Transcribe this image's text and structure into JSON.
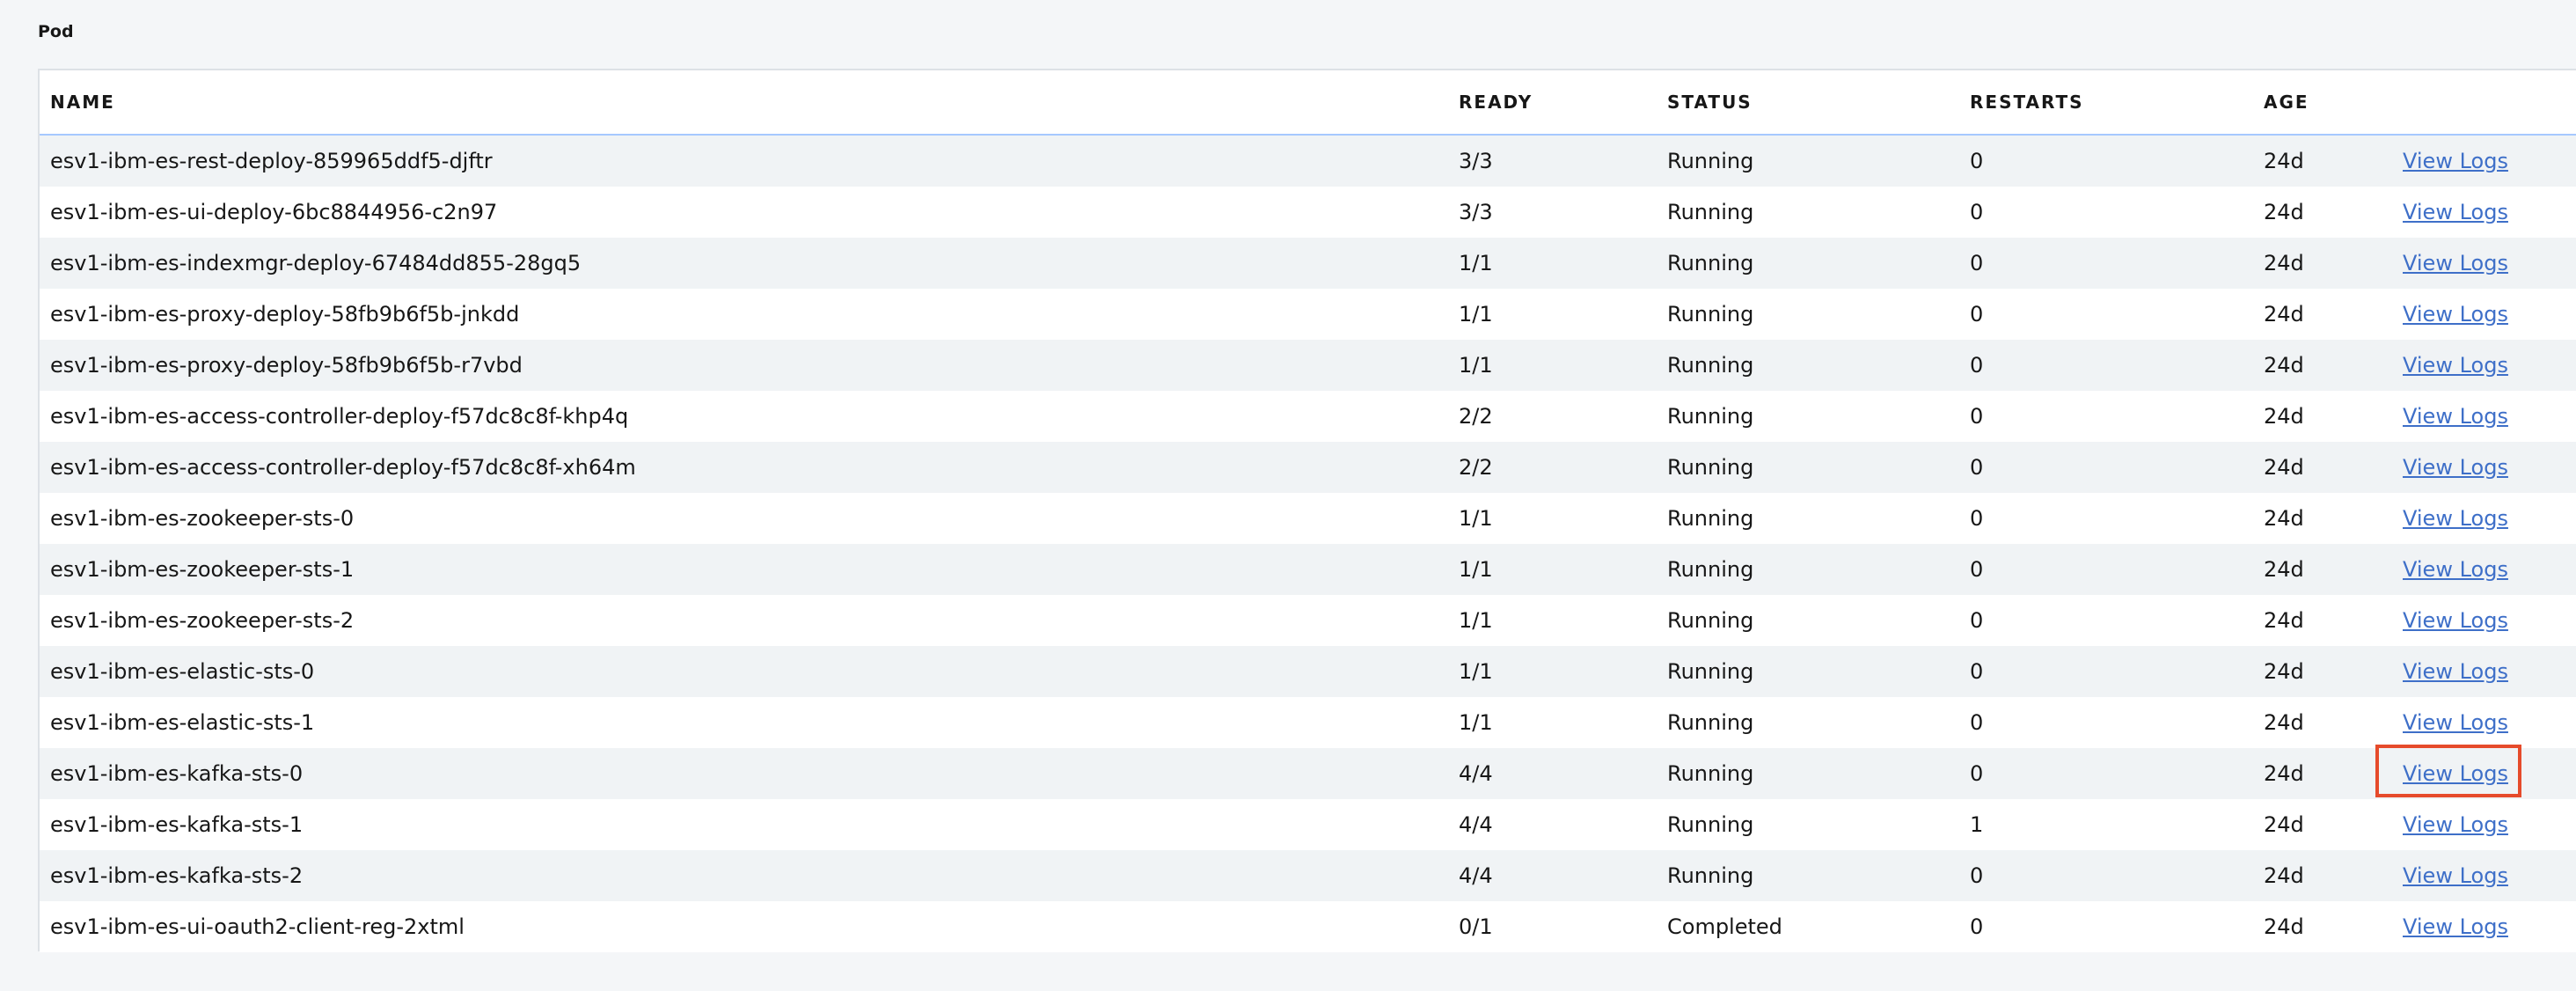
{
  "section": {
    "title": "Pod"
  },
  "table": {
    "columns": [
      "NAME",
      "READY",
      "STATUS",
      "RESTARTS",
      "AGE"
    ],
    "action_label": "View Logs",
    "rows": [
      {
        "name": "esv1-ibm-es-rest-deploy-859965ddf5-djftr",
        "ready": "3/3",
        "status": "Running",
        "restarts": "0",
        "age": "24d",
        "logs": "View Logs"
      },
      {
        "name": "esv1-ibm-es-ui-deploy-6bc8844956-c2n97",
        "ready": "3/3",
        "status": "Running",
        "restarts": "0",
        "age": "24d",
        "logs": "View Logs"
      },
      {
        "name": "esv1-ibm-es-indexmgr-deploy-67484dd855-28gq5",
        "ready": "1/1",
        "status": "Running",
        "restarts": "0",
        "age": "24d",
        "logs": "View Logs"
      },
      {
        "name": "esv1-ibm-es-proxy-deploy-58fb9b6f5b-jnkdd",
        "ready": "1/1",
        "status": "Running",
        "restarts": "0",
        "age": "24d",
        "logs": "View Logs"
      },
      {
        "name": "esv1-ibm-es-proxy-deploy-58fb9b6f5b-r7vbd",
        "ready": "1/1",
        "status": "Running",
        "restarts": "0",
        "age": "24d",
        "logs": "View Logs"
      },
      {
        "name": "esv1-ibm-es-access-controller-deploy-f57dc8c8f-khp4q",
        "ready": "2/2",
        "status": "Running",
        "restarts": "0",
        "age": "24d",
        "logs": "View Logs"
      },
      {
        "name": "esv1-ibm-es-access-controller-deploy-f57dc8c8f-xh64m",
        "ready": "2/2",
        "status": "Running",
        "restarts": "0",
        "age": "24d",
        "logs": "View Logs"
      },
      {
        "name": "esv1-ibm-es-zookeeper-sts-0",
        "ready": "1/1",
        "status": "Running",
        "restarts": "0",
        "age": "24d",
        "logs": "View Logs"
      },
      {
        "name": "esv1-ibm-es-zookeeper-sts-1",
        "ready": "1/1",
        "status": "Running",
        "restarts": "0",
        "age": "24d",
        "logs": "View Logs"
      },
      {
        "name": "esv1-ibm-es-zookeeper-sts-2",
        "ready": "1/1",
        "status": "Running",
        "restarts": "0",
        "age": "24d",
        "logs": "View Logs"
      },
      {
        "name": "esv1-ibm-es-elastic-sts-0",
        "ready": "1/1",
        "status": "Running",
        "restarts": "0",
        "age": "24d",
        "logs": "View Logs"
      },
      {
        "name": "esv1-ibm-es-elastic-sts-1",
        "ready": "1/1",
        "status": "Running",
        "restarts": "0",
        "age": "24d",
        "logs": "View Logs"
      },
      {
        "name": "esv1-ibm-es-kafka-sts-0",
        "ready": "4/4",
        "status": "Running",
        "restarts": "0",
        "age": "24d",
        "logs": "View Logs"
      },
      {
        "name": "esv1-ibm-es-kafka-sts-1",
        "ready": "4/4",
        "status": "Running",
        "restarts": "1",
        "age": "24d",
        "logs": "View Logs"
      },
      {
        "name": "esv1-ibm-es-kafka-sts-2",
        "ready": "4/4",
        "status": "Running",
        "restarts": "0",
        "age": "24d",
        "logs": "View Logs"
      },
      {
        "name": "esv1-ibm-es-ui-oauth2-client-reg-2xtml",
        "ready": "0/1",
        "status": "Completed",
        "restarts": "0",
        "age": "24d",
        "logs": "View Logs"
      }
    ]
  },
  "colors": {
    "link": "#3e6fc8",
    "highlight": "#e64b2b",
    "row_alt": "#f0f3f5",
    "header_border": "#a6c8ff"
  }
}
